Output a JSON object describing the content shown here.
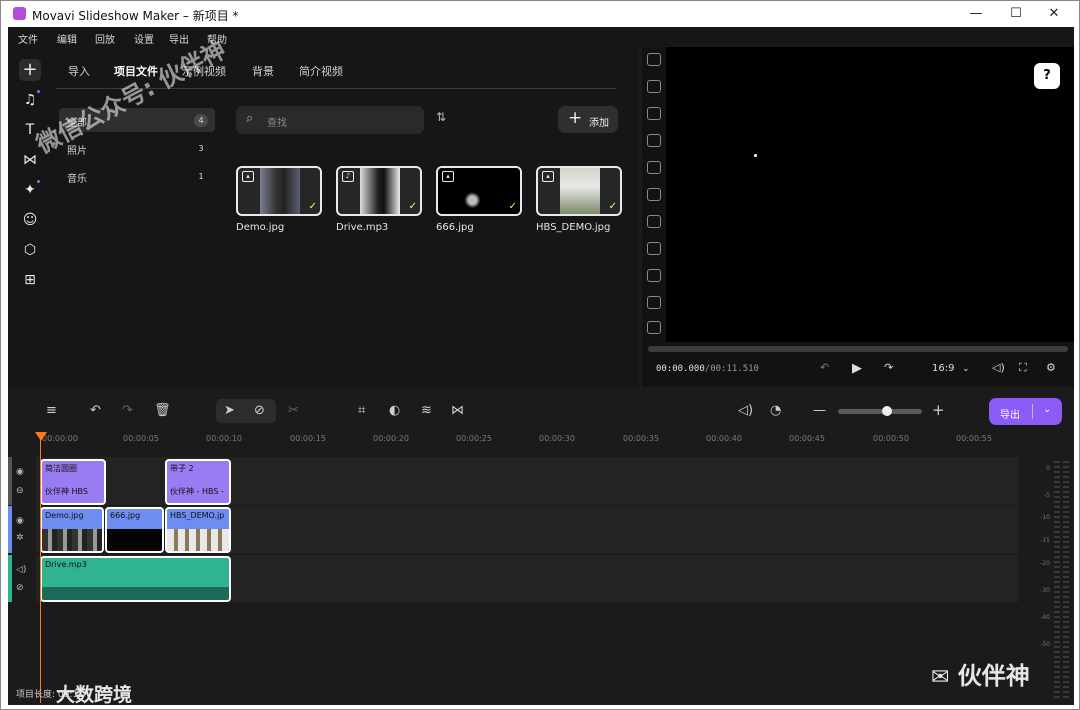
{
  "window": {
    "title": "Movavi Slideshow Maker – 新项目 *",
    "minimize": "—",
    "maximize": "☐",
    "close": "✕"
  },
  "menu": [
    "文件",
    "编辑",
    "回放",
    "设置",
    "导出",
    "帮助"
  ],
  "tools": [
    "plus-icon",
    "music-note-icon",
    "text-icon",
    "transition-icon",
    "magic-wand-icon",
    "sticker-icon",
    "shapes-icon",
    "more-apps-icon"
  ],
  "library": {
    "tabs": [
      "导入",
      "项目文件",
      "示例视频",
      "背景",
      "简介视频"
    ],
    "active_tab": "项目文件",
    "categories": [
      {
        "label": "全部",
        "count": "4"
      },
      {
        "label": "照片",
        "count": "3"
      },
      {
        "label": "音乐",
        "count": "1"
      }
    ],
    "search_placeholder": "查找",
    "add_label": "添加",
    "media": [
      {
        "name": "Demo.jpg",
        "icon": "image-icon"
      },
      {
        "name": "Drive.mp3",
        "icon": "music-icon"
      },
      {
        "name": "666.jpg",
        "icon": "image-icon"
      },
      {
        "name": "HBS_DEMO.jpg",
        "icon": "image-icon"
      }
    ]
  },
  "preview": {
    "help": "?",
    "timecode_current": "00:00.000",
    "timecode_total": "/00:11.510",
    "aspect": "16:9"
  },
  "timeline": {
    "export_label": "导出",
    "ruler": [
      "00:00:00",
      "00:00:05",
      "00:00:10",
      "00:00:15",
      "00:00:20",
      "00:00:25",
      "00:00:30",
      "00:00:35",
      "00:00:40",
      "00:00:45",
      "00:00:50",
      "00:00:55"
    ],
    "text_clips": [
      {
        "top": "简洁圆圈",
        "bottom": "伙伴神 HBS"
      },
      {
        "top": "带子 2",
        "bottom": "伙伴神 - HBS -"
      }
    ],
    "video_clips": [
      "Demo.jpg",
      "666.jpg",
      "HBS_DEMO.jp"
    ],
    "audio_clip": "Drive.mp3",
    "meter_labels": [
      "0",
      "-5",
      "-10",
      "-15",
      "-20",
      "-30",
      "-40",
      "-50"
    ],
    "footer": "项目长度: 00:11"
  },
  "watermarks": {
    "diagonal": "微信公众号: 伙伴神",
    "logo": "伙伴神",
    "corner": "大数跨境"
  },
  "colors": {
    "accent": "#8a5cf5",
    "playhead": "#ff7a1a",
    "audio": "#2fb391",
    "video": "#6d8ef0",
    "text": "#9a7cf2"
  }
}
